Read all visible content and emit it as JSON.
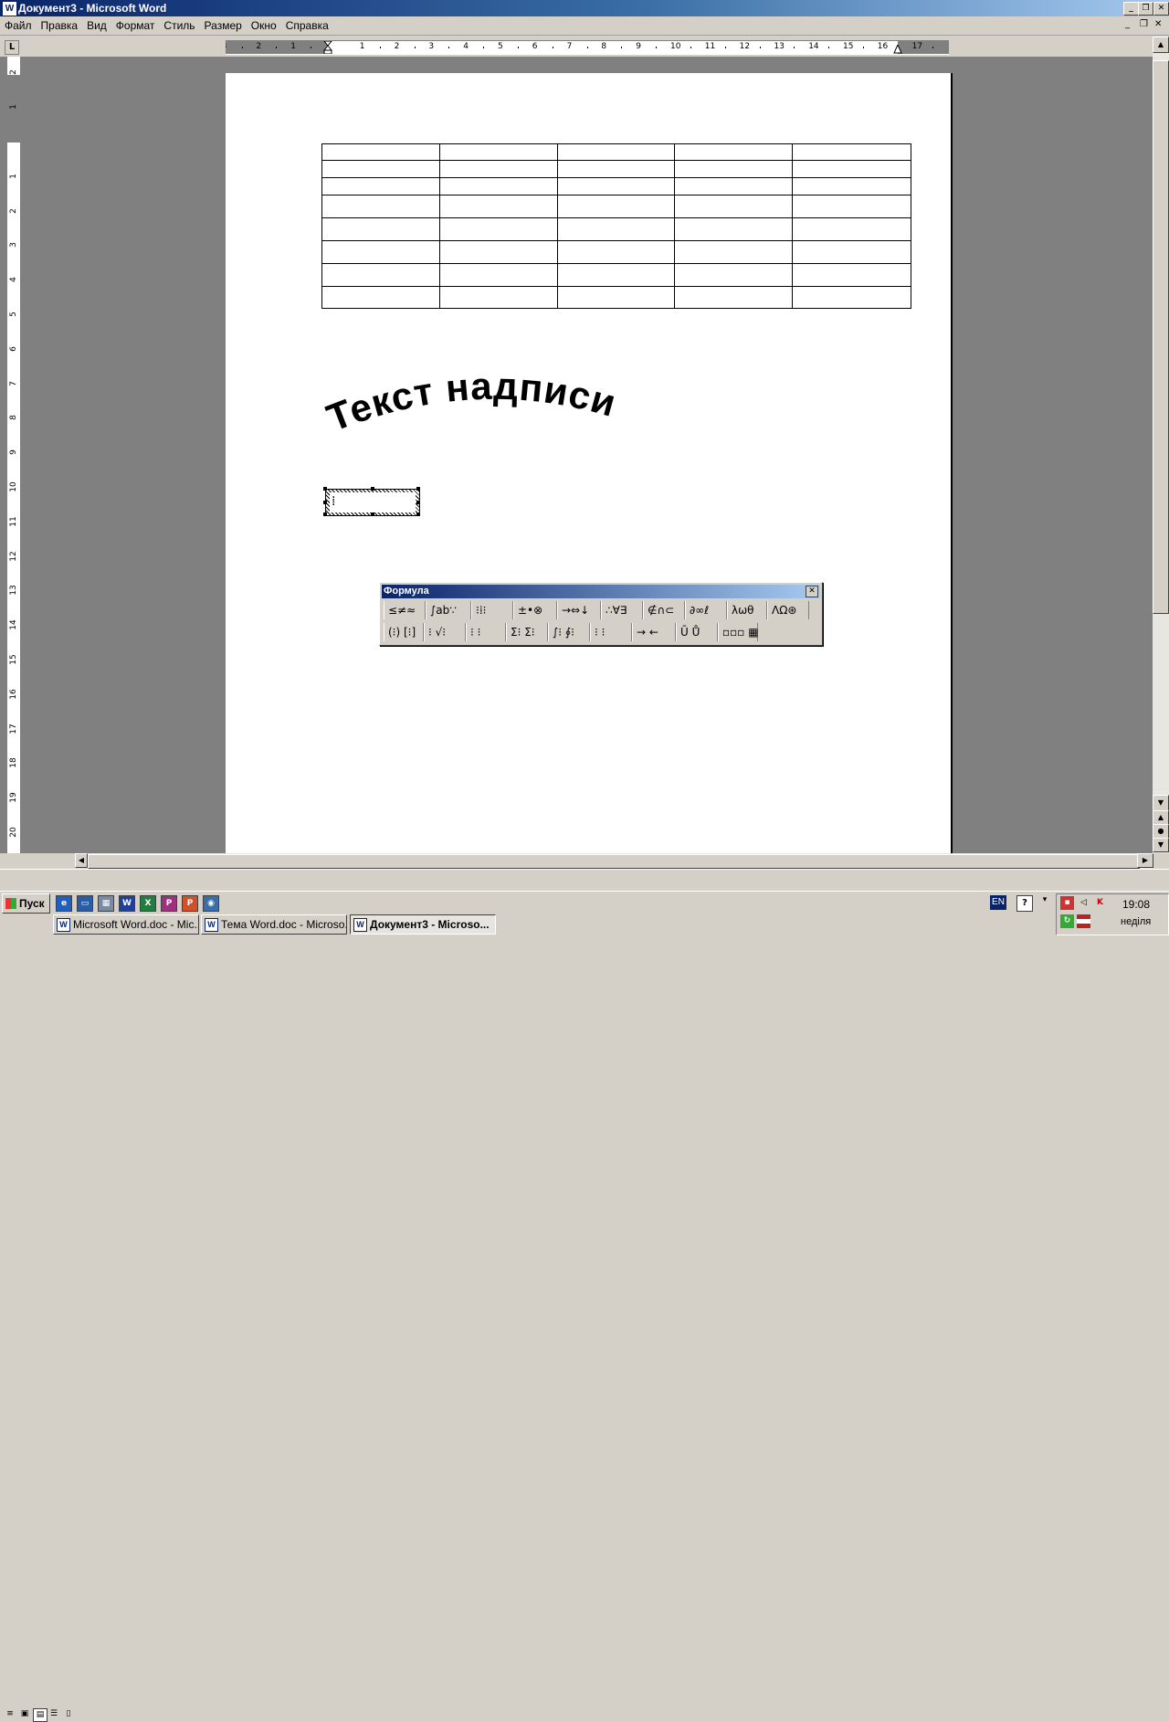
{
  "window": {
    "title": "Документ3 - Microsoft Word",
    "app_icon": "W",
    "controls": [
      "_",
      "❐",
      "✕"
    ]
  },
  "menu": {
    "items": [
      "Файл",
      "Правка",
      "Вид",
      "Формат",
      "Стиль",
      "Размер",
      "Окно",
      "Справка"
    ],
    "doc_controls": [
      "_",
      "❐",
      "✕"
    ]
  },
  "ruler": {
    "tab_selector": "L",
    "h_labels": [
      "3",
      "2",
      "1",
      "1",
      "2",
      "3",
      "4",
      "5",
      "6",
      "7",
      "8",
      "9",
      "10",
      "11",
      "12",
      "13",
      "14",
      "15",
      "16",
      "17"
    ],
    "v_labels": [
      "2",
      "1",
      "1",
      "2",
      "3",
      "4",
      "5",
      "6",
      "7",
      "8",
      "9",
      "10",
      "11",
      "12",
      "13",
      "14",
      "15",
      "16",
      "17",
      "18",
      "19",
      "20"
    ]
  },
  "document": {
    "table": {
      "rows": 8,
      "cols": 5
    },
    "wordart_text": "Текст надписи",
    "equation_cursor": "⁞"
  },
  "formula_toolbar": {
    "title": "Формула",
    "close": "✕",
    "row1": [
      "≤≠≈",
      "∫ab∵",
      "⁝⁞⁝",
      "±•⊗",
      "→⇔↓",
      "∴∀∃",
      "∉∩⊂",
      "∂∞ℓ",
      "λωθ",
      "ΛΩ⊛"
    ],
    "row2": [
      "(⁝) [⁝]",
      "⁝ √⁝",
      "⁝ ⁝",
      "Σ⁝ Σ⁝",
      "∫⁝ ∮⁝",
      "⁝ ⁝",
      "→ ←",
      "Ū Ů",
      "▫▫▫ ▦"
    ]
  },
  "scrollbars": {
    "up": "▲",
    "down": "▼",
    "left": "◀",
    "right": "▶",
    "prev_page": "▲",
    "select_browse": "●",
    "next_page": "▼"
  },
  "view_buttons": [
    "≡",
    "▣",
    "▤",
    "☰",
    "▯"
  ],
  "taskbar": {
    "start_label": "Пуск",
    "quicklaunch": [
      {
        "icon": "ie-icon",
        "glyph": "e",
        "color": "#1e5fc0"
      },
      {
        "icon": "desktop-icon",
        "glyph": "▭",
        "color": "#2a5da8"
      },
      {
        "icon": "calculator-icon",
        "glyph": "▦",
        "color": "#7a8aa0"
      },
      {
        "icon": "word-icon",
        "glyph": "W",
        "color": "#1f3f9f"
      },
      {
        "icon": "excel-icon",
        "glyph": "X",
        "color": "#1f7f3f"
      },
      {
        "icon": "publisher-icon",
        "glyph": "P",
        "color": "#9f2f7f"
      },
      {
        "icon": "powerpoint-icon",
        "glyph": "P",
        "color": "#d0502a"
      },
      {
        "icon": "media-icon",
        "glyph": "◉",
        "color": "#3a6ea5"
      }
    ],
    "tasks": [
      {
        "label": "Microsoft Word.doc - Mic...",
        "active": false
      },
      {
        "label": "Тема Word.doc - Microso...",
        "active": false
      },
      {
        "label": "Документ3 - Microso...",
        "active": true
      }
    ],
    "language": "EN",
    "clock": "19:08",
    "day": "неділя"
  }
}
